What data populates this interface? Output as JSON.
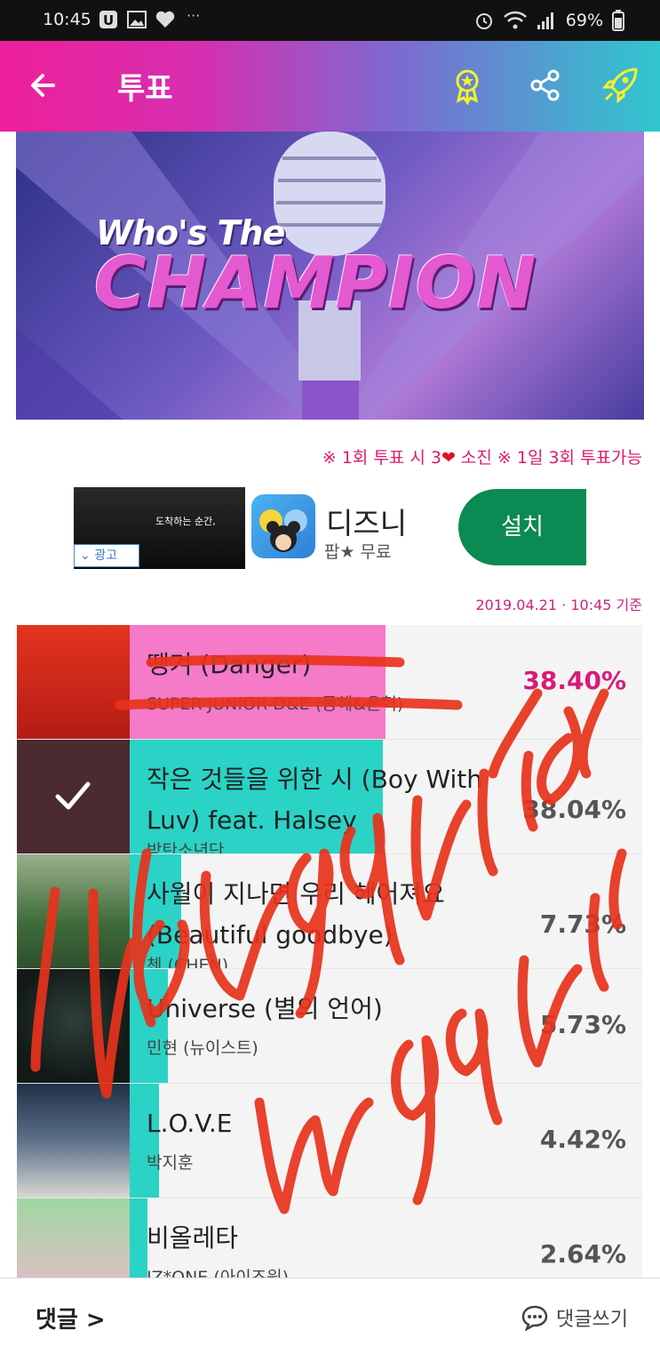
{
  "status_bar": {
    "time": "10:45",
    "battery": "69%"
  },
  "header": {
    "title": "투표"
  },
  "banner": {
    "line1": "Who's The",
    "line2": "CHAMPION"
  },
  "notice": {
    "part1": "※ 1회 투표 시 3",
    "part2": " 소진  ※ 1일 3회 투표가능"
  },
  "ad": {
    "video_caption": "도착하는 순간,",
    "label": "광고",
    "app_name": "디즈니",
    "sub": "팝★ 무료",
    "install": "설치"
  },
  "timestamp": "2019.04.21 · 10:45 기준",
  "candidates": [
    {
      "song": "땡겨 (Danger)",
      "artist": "SUPER JUNIOR-D&E (동해&은혁)",
      "percent": "38.40%",
      "share": 0.384,
      "bar_color": "#f57ac8"
    },
    {
      "song": "작은 것들을 위한 시 (Boy With Luv) feat. Halsey",
      "artist": "방탄소년단",
      "percent": "38.04%",
      "share": 0.3804,
      "bar_color": "#2ad3c6"
    },
    {
      "song": "사월이 지나면 우리 헤어져요 (Beautiful goodbye)",
      "artist": "첸 (CHEN)",
      "percent": "7.73%",
      "share": 0.0773,
      "bar_color": "#2ad3c6"
    },
    {
      "song": "Universe (별의 언어)",
      "artist": "민현 (뉴이스트)",
      "percent": "5.73%",
      "share": 0.0573,
      "bar_color": "#2ad3c6"
    },
    {
      "song": "L.O.V.E",
      "artist": "박지훈",
      "percent": "4.42%",
      "share": 0.0442,
      "bar_color": "#2ad3c6"
    },
    {
      "song": "비올레타",
      "artist": "IZ*ONE (아이즈원)",
      "percent": "2.64%",
      "share": 0.0264,
      "bar_color": "#2ad3c6"
    }
  ],
  "footer": {
    "comments": "댓글 >",
    "write": "댓글쓰기"
  },
  "overlay": {
    "word1": "bangyuri",
    "word2": "mogyuri"
  }
}
